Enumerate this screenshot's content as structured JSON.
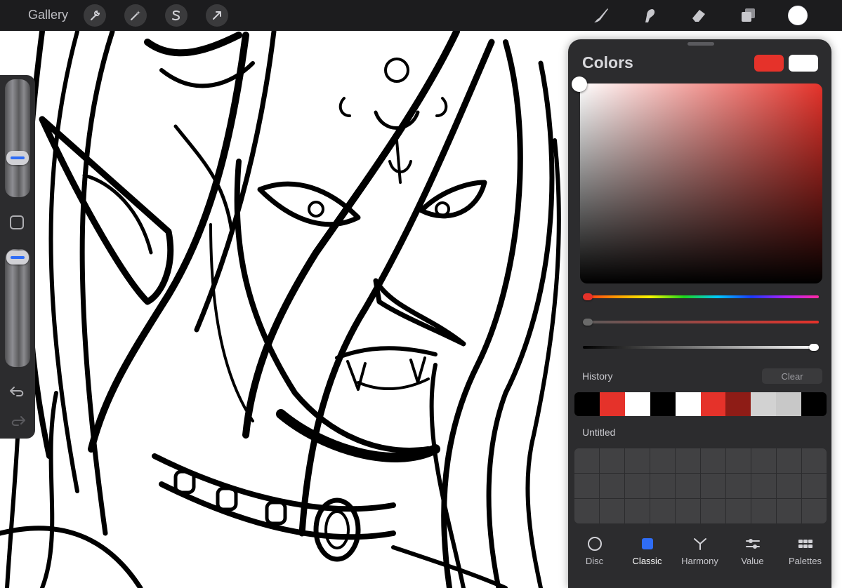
{
  "topbar": {
    "gallery_label": "Gallery",
    "actions": [
      {
        "name": "wrench-icon"
      },
      {
        "name": "magic-wand-icon"
      },
      {
        "name": "selection-s-icon"
      },
      {
        "name": "transform-arrow-icon"
      }
    ],
    "tools": [
      {
        "name": "brush-icon"
      },
      {
        "name": "smudge-icon"
      },
      {
        "name": "eraser-icon"
      },
      {
        "name": "layers-icon"
      }
    ],
    "current_color": "#ffffff"
  },
  "sidebar": {
    "brush_size_icon": "slider-handle",
    "modify_icon": "square-icon",
    "opacity_icon": "slider-handle",
    "undo_icon": "undo-icon",
    "redo_icon": "redo-icon"
  },
  "colors_panel": {
    "title": "Colors",
    "primary_color": "#e5322a",
    "secondary_color": "#ffffff",
    "hue_level": 0.0,
    "saturation_level": 0.0,
    "brightness_level": 1.0,
    "history": {
      "label": "History",
      "clear_label": "Clear",
      "swatches": [
        "#000000",
        "#e5322a",
        "#ffffff",
        "#000000",
        "#ffffff",
        "#e5322a",
        "#8e1c16",
        "#d2d2d2",
        "#c8c8c8",
        "#000000"
      ]
    },
    "palette": {
      "name": "Untitled",
      "cells": 30
    },
    "tabs": [
      {
        "label": "Disc",
        "icon": "disc-icon",
        "active": false
      },
      {
        "label": "Classic",
        "icon": "classic-square-icon",
        "active": true
      },
      {
        "label": "Harmony",
        "icon": "harmony-icon",
        "active": false
      },
      {
        "label": "Value",
        "icon": "value-sliders-icon",
        "active": false
      },
      {
        "label": "Palettes",
        "icon": "palettes-grid-icon",
        "active": false
      }
    ]
  }
}
